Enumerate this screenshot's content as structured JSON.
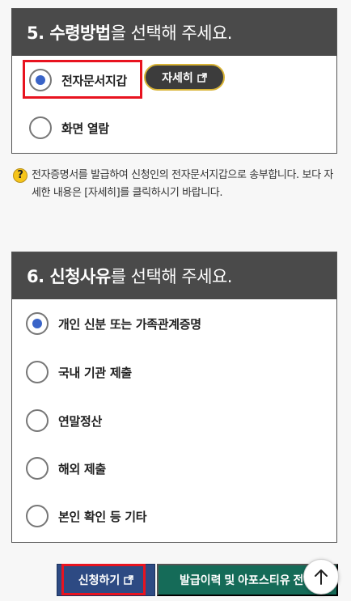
{
  "section5": {
    "heading_strong": "5. 수령방법",
    "heading_rest": "을 선택해 주세요.",
    "options": [
      {
        "label": "전자문서지갑",
        "checked": true
      },
      {
        "label": "화면 열람",
        "checked": false
      }
    ],
    "detail_button": "자세히",
    "notice_icon": "?",
    "notice": "전자증명서를 발급하여 신청인의 전자문서지갑으로 송부합니다. 보다 자세한 내용은 [자세히]를 클릭하시기 바랍니다."
  },
  "section6": {
    "heading_strong": "6. 신청사유",
    "heading_rest": "를 선택해 주세요.",
    "options": [
      {
        "label": "개인 신분 또는 가족관계증명",
        "checked": true
      },
      {
        "label": "국내 기관 제출",
        "checked": false
      },
      {
        "label": "연말정산",
        "checked": false
      },
      {
        "label": "해외 제출",
        "checked": false
      },
      {
        "label": "본인 확인 등 기타",
        "checked": false
      }
    ]
  },
  "footer": {
    "apply_button": "신청하기",
    "history_button": "발급이력 및 아포스티유 전",
    "top_button_icon": "arrow-up-icon"
  },
  "colors": {
    "header_bg": "#4a4a4a",
    "radio_selected": "#3a64c8",
    "highlight": "#e8131f",
    "apply_bg": "#2d4a83",
    "history_bg": "#156b58",
    "detail_border": "#d8b335"
  }
}
